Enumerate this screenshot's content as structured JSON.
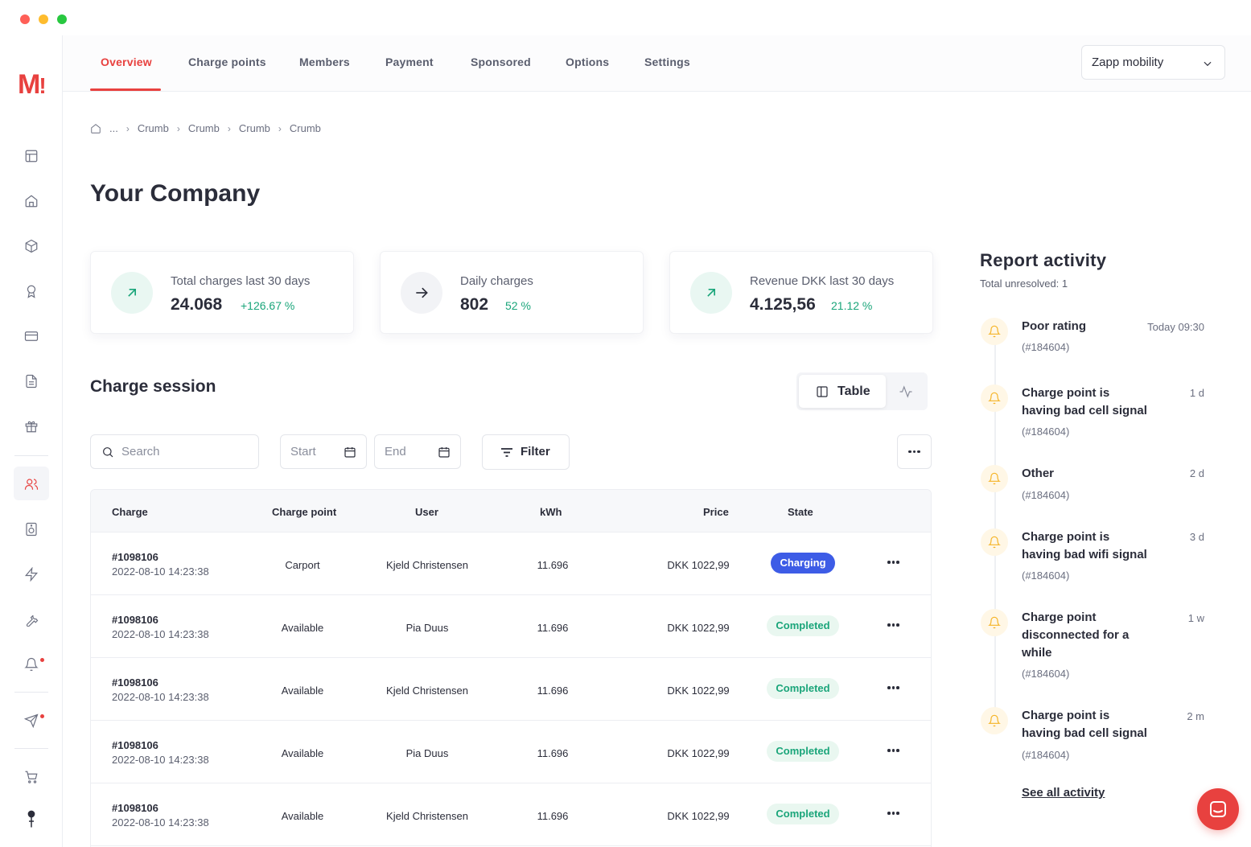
{
  "app": {
    "logo_text": "M",
    "logo_mark": "!"
  },
  "nav": {
    "tabs": [
      {
        "label": "Overview",
        "active": true
      },
      {
        "label": "Charge points"
      },
      {
        "label": "Members"
      },
      {
        "label": "Payment"
      },
      {
        "label": "Sponsored"
      },
      {
        "label": "Options"
      },
      {
        "label": "Settings"
      }
    ],
    "org_select": "Zapp mobility"
  },
  "breadcrumb": {
    "ellipsis": "...",
    "items": [
      "Crumb",
      "Crumb",
      "Crumb",
      "Crumb"
    ]
  },
  "page": {
    "title": "Your Company"
  },
  "stats": [
    {
      "label": "Total charges last 30 days",
      "value": "24.068",
      "delta": "+126.67 %",
      "icon": "arrow-up-right-icon"
    },
    {
      "label": "Daily charges",
      "value": "802",
      "delta": "52 %",
      "icon": "arrow-right-icon"
    },
    {
      "label": "Revenue DKK last 30 days",
      "value": "4.125,56",
      "delta": "21.12 %",
      "icon": "arrow-up-right-icon"
    }
  ],
  "session": {
    "title": "Charge session",
    "view_table": "Table",
    "search_placeholder": "Search",
    "start_placeholder": "Start",
    "end_placeholder": "End",
    "filter_label": "Filter"
  },
  "table": {
    "columns": [
      "Charge",
      "Charge point",
      "User",
      "kWh",
      "Price",
      "State"
    ],
    "rows": [
      {
        "id": "#1098106",
        "date": "2022-08-10 14:23:38",
        "point": "Carport",
        "user": "Kjeld Christensen",
        "kwh": "11.696",
        "price": "DKK 1022,99",
        "state": "Charging"
      },
      {
        "id": "#1098106",
        "date": "2022-08-10 14:23:38",
        "point": "Available",
        "user": "Pia Duus",
        "kwh": "11.696",
        "price": "DKK 1022,99",
        "state": "Completed"
      },
      {
        "id": "#1098106",
        "date": "2022-08-10 14:23:38",
        "point": "Available",
        "user": "Kjeld Christensen",
        "kwh": "11.696",
        "price": "DKK 1022,99",
        "state": "Completed"
      },
      {
        "id": "#1098106",
        "date": "2022-08-10 14:23:38",
        "point": "Available",
        "user": "Pia Duus",
        "kwh": "11.696",
        "price": "DKK 1022,99",
        "state": "Completed"
      },
      {
        "id": "#1098106",
        "date": "2022-08-10 14:23:38",
        "point": "Available",
        "user": "Kjeld Christensen",
        "kwh": "11.696",
        "price": "DKK 1022,99",
        "state": "Completed"
      }
    ]
  },
  "report": {
    "title": "Report activity",
    "subtitle": "Total unresolved: 1",
    "items": [
      {
        "title": "Poor rating",
        "ref": "(#184604)",
        "time": "Today 09:30"
      },
      {
        "title": "Charge point is having bad cell signal",
        "ref": "(#184604)",
        "time": "1 d"
      },
      {
        "title": "Other",
        "ref": "(#184604)",
        "time": "2 d"
      },
      {
        "title": "Charge point is having bad wifi signal",
        "ref": "(#184604)",
        "time": "3 d"
      },
      {
        "title": "Charge point disconnected for a while",
        "ref": "(#184604)",
        "time": "1 w"
      },
      {
        "title": "Charge point is having bad cell signal",
        "ref": "(#184604)",
        "time": "2 m"
      }
    ],
    "see_all": "See all activity"
  },
  "colors": {
    "brand": "#e8413f",
    "positive": "#1aa57a",
    "charging": "#3d5ce6",
    "warning": "#f5b324"
  }
}
